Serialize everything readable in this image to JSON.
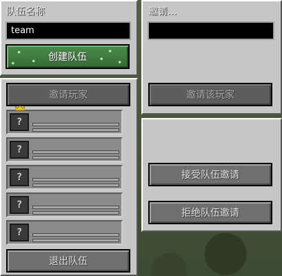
{
  "left": {
    "team_name_label": "队伍名称",
    "team_name_value": "team",
    "create_team_button": "创建队伍",
    "invite_players_button": "邀请玩家",
    "slot_icon": "?",
    "leave_team_button": "退出队伍"
  },
  "right_top": {
    "invite_label": "邀请...",
    "invite_input_value": "",
    "invite_player_button": "邀请该玩家"
  },
  "right_bottom": {
    "accept_button": "接受队伍邀请",
    "reject_button": "拒绝队伍邀请"
  },
  "colors": {
    "panel": "#c6c6c6",
    "button": "#6f6f6f",
    "create_button": "#3f7a3f",
    "leader_crown": "#f0c020"
  },
  "icons": {
    "slot_head": "unknown-player-icon",
    "leader": "crown-icon"
  }
}
